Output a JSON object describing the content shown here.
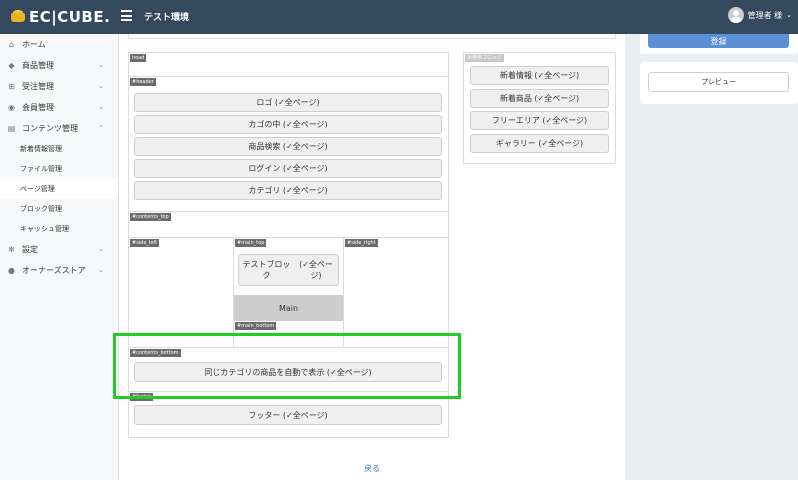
{
  "header": {
    "logo_text": "EC|CUBE.",
    "shop_name": "テスト環境",
    "user_name": "管理者 様",
    "caret": "⌄"
  },
  "sidebar": {
    "items": [
      {
        "label": "ホーム",
        "icon": "home-icon",
        "glyph": "⌂"
      },
      {
        "label": "商品管理",
        "icon": "tag-icon",
        "glyph": "◆"
      },
      {
        "label": "受注管理",
        "icon": "cart-icon",
        "glyph": "⊞"
      },
      {
        "label": "会員管理",
        "icon": "users-icon",
        "glyph": "◉"
      },
      {
        "label": "コンテンツ管理",
        "icon": "file-icon",
        "glyph": "▤"
      }
    ],
    "sub_items": [
      "新着情報管理",
      "ファイル管理",
      "ページ管理",
      "ブロック管理",
      "キャッシュ管理"
    ],
    "items_bottom": [
      {
        "label": "設定",
        "icon": "gear-icon",
        "glyph": "✻"
      },
      {
        "label": "オーナーズストア",
        "icon": "info-icon",
        "glyph": "●"
      }
    ],
    "chev_down": "⌄",
    "chev_up": "⌃"
  },
  "layout": {
    "head_tag": "head",
    "header_tag": "#header",
    "header_blocks": [
      "ロゴ (✓全ページ)",
      "カゴの中 (✓全ページ)",
      "商品検索 (✓全ページ)",
      "ログイン (✓全ページ)",
      "カテゴリ (✓全ページ)"
    ],
    "contents_top_tag": "#contents_top",
    "side_left_tag": "#side_left",
    "main_top_tag": "#main_top",
    "side_right_tag": "#side_right",
    "main_top_block_line1": "テストブロック",
    "main_top_block_line2": "(✓全ページ)",
    "main_label": "Main",
    "main_bottom_tag": "#main_bottom",
    "contents_bottom_tag": "#contents_bottom",
    "contents_bottom_block": "同じカテゴリの商品を自動で表示 (✓全ページ)",
    "footer_tag": "#footer",
    "footer_block": "フッター (✓全ページ)"
  },
  "unused_blocks": {
    "tag": "未使用ブロック",
    "items": [
      "新着情報 (✓全ページ)",
      "新着商品 (✓全ページ)",
      "フリーエリア (✓全ページ)",
      "ギャラリー (✓全ページ)"
    ]
  },
  "actions": {
    "save_label": "登録",
    "preview_label": "プレビュー",
    "back_label": "戻る"
  },
  "colors": {
    "header_bg": "#34495e",
    "primary": "#5c8fd6",
    "highlight": "#22cc22",
    "link": "#437ec4"
  }
}
